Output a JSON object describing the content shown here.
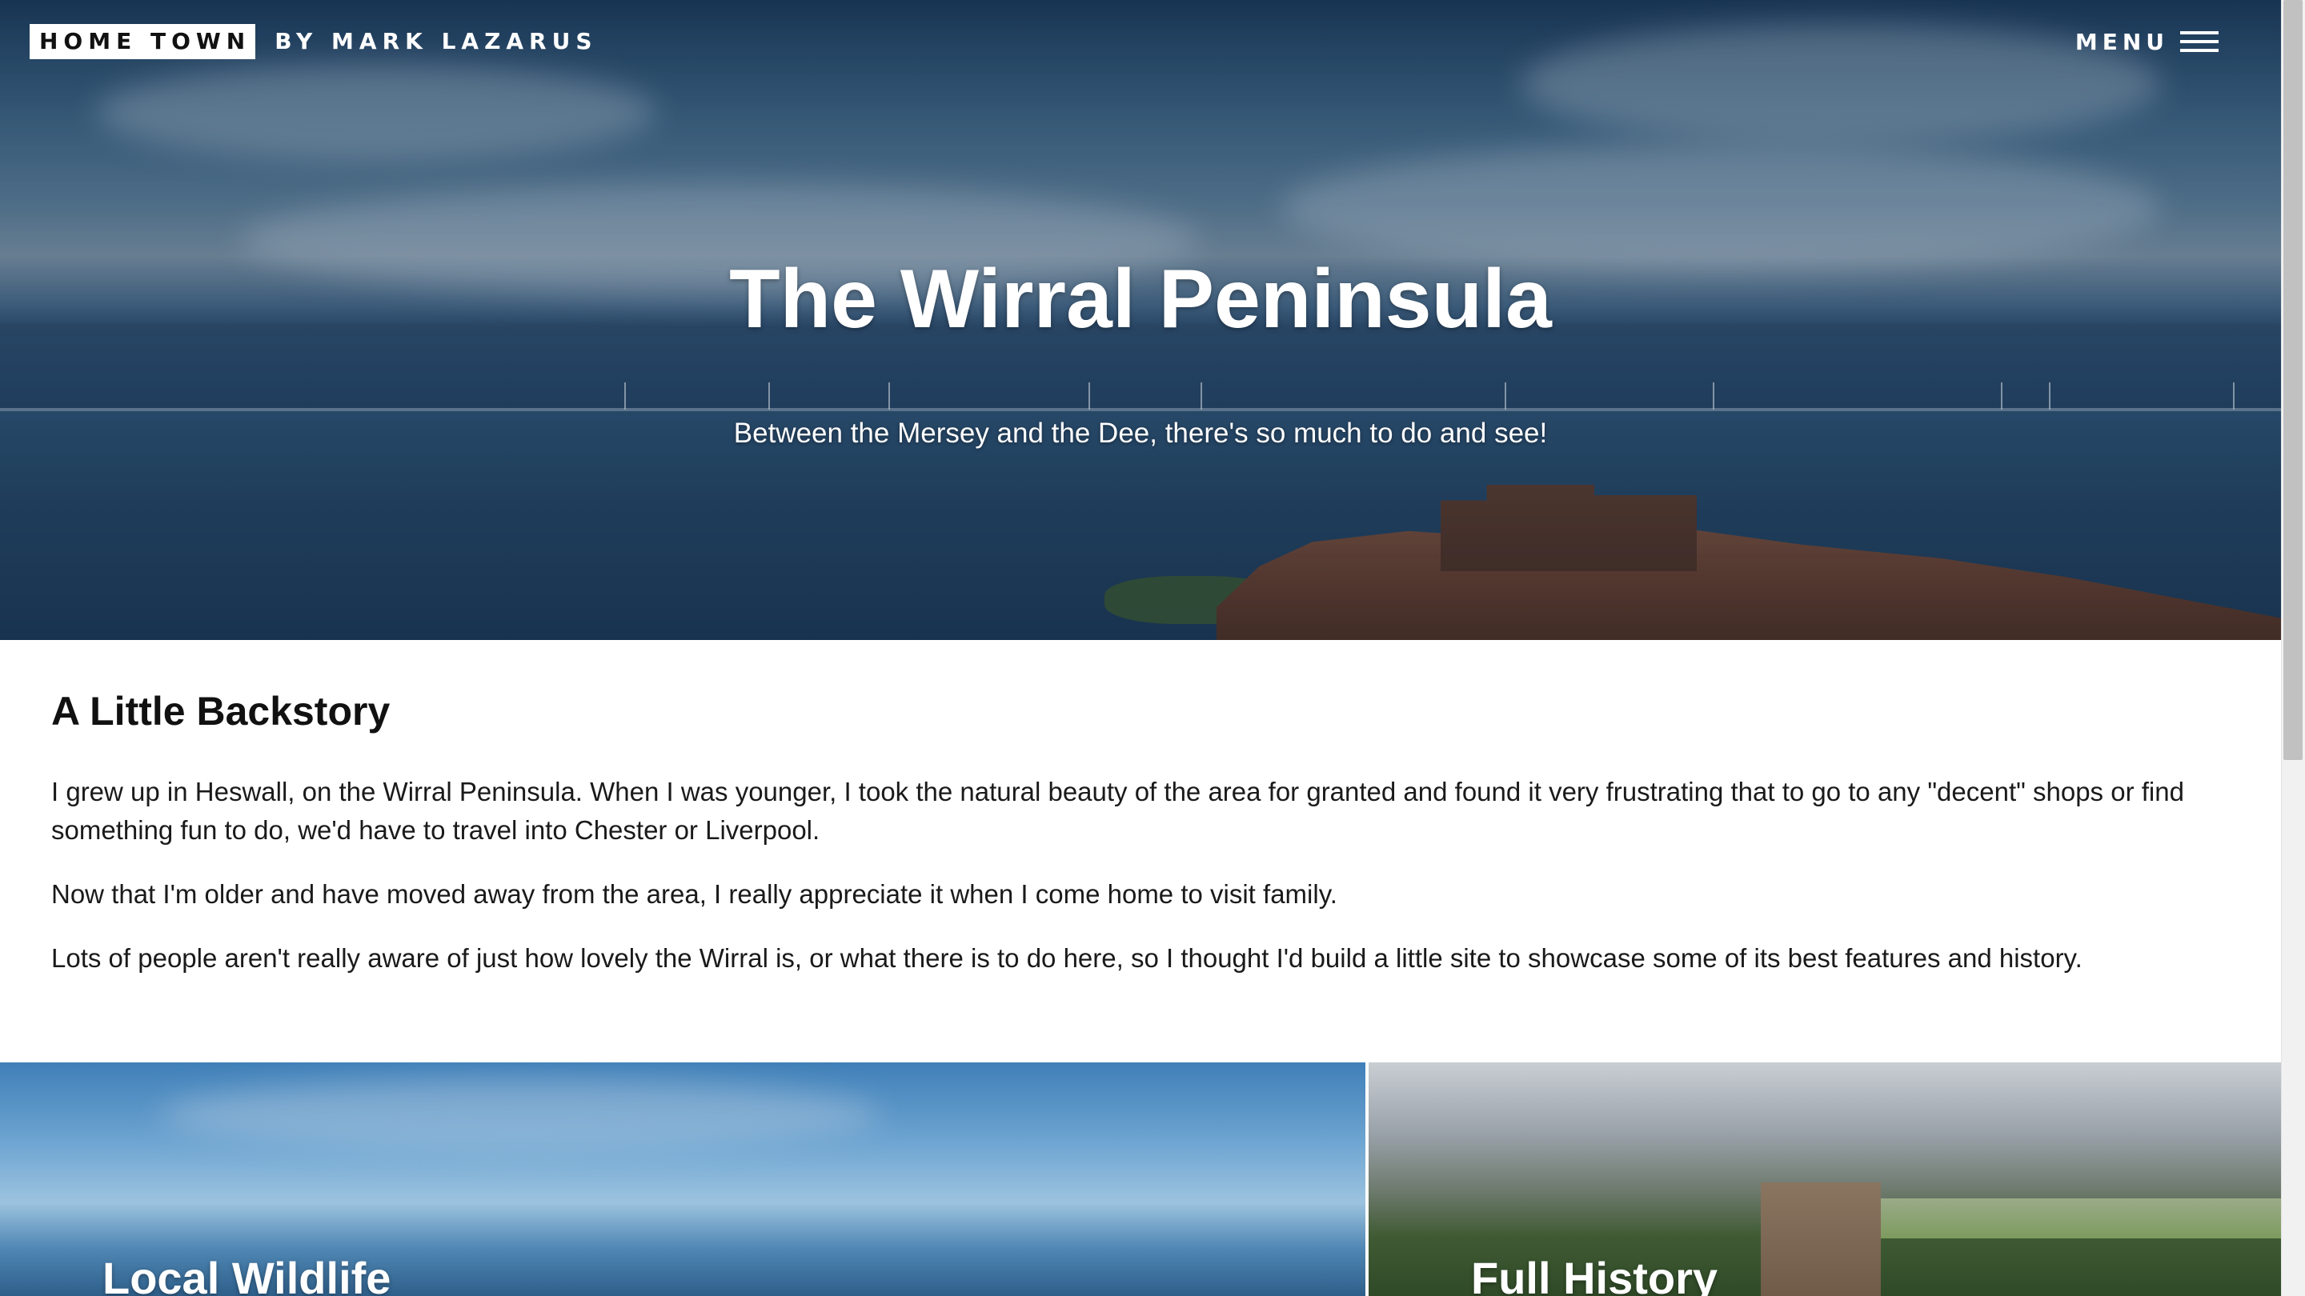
{
  "nav": {
    "brand_box": "HOME TOWN",
    "brand_by": "BY MARK LAZARUS",
    "menu_label": "MENU",
    "menu_icon": "hamburger-icon"
  },
  "hero": {
    "title": "The Wirral Peninsula",
    "subtitle": "Between the Mersey and the Dee, there's so much to do and see!"
  },
  "backstory": {
    "heading": "A Little Backstory",
    "paragraphs": [
      "I grew up in Heswall, on the Wirral Peninsula. When I was younger, I took the natural beauty of the area for granted and found it very frustrating that to go to any \"decent\" shops or find something fun to do, we'd have to travel into Chester or Liverpool.",
      "Now that I'm older and have moved away from the area, I really appreciate it when I come home to visit family.",
      "Lots of people aren't really aware of just how lovely the Wirral is, or what there is to do here, so I thought I'd build a little site to showcase some of its best features and history."
    ]
  },
  "cards": [
    {
      "title": "Local Wildlife"
    },
    {
      "title": "Full History"
    }
  ]
}
